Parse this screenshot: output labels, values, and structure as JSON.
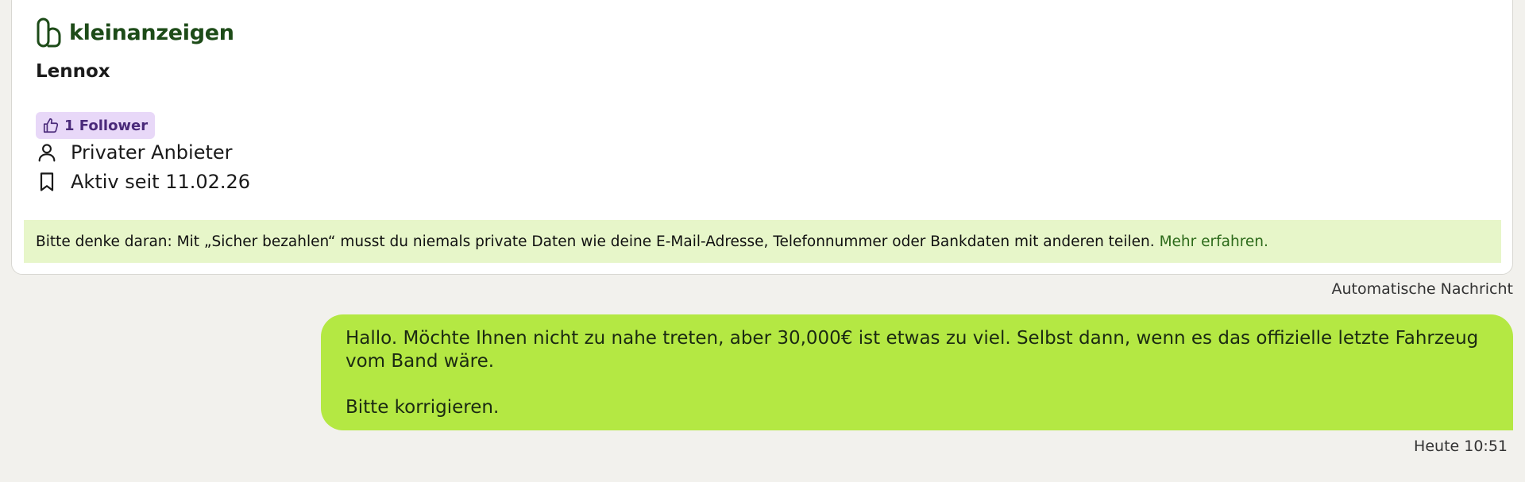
{
  "logo": {
    "text": "kleinanzeigen",
    "icon": "kleinanzeigen-logo-icon"
  },
  "seller": {
    "name": "Lennox",
    "follower_badge": "1 Follower",
    "type": "Privater Anbieter",
    "active_since": "Aktiv seit 11.02.26"
  },
  "notice": {
    "text": "Bitte denke daran: Mit „Sicher bezahlen“ musst du niemals private Daten wie deine E-Mail-Adresse, Telefonnummer oder Bankdaten mit anderen teilen.",
    "link": "Mehr erfahren."
  },
  "chat": {
    "auto_label": "Automatische Nachricht",
    "message_line1": "Hallo. Möchte Ihnen nicht zu nahe treten, aber 30,000€ ist etwas zu viel. Selbst dann, wenn es das offizielle letzte Fahrzeug",
    "message_line2": "vom Band wäre.",
    "message_line3": "Bitte korrigieren.",
    "timestamp": "Heute 10:51"
  },
  "colors": {
    "brand_green": "#1d4b18",
    "bubble_green": "#b4e843",
    "notice_bg": "#e7f6c9",
    "badge_bg": "#e8d8f8"
  }
}
